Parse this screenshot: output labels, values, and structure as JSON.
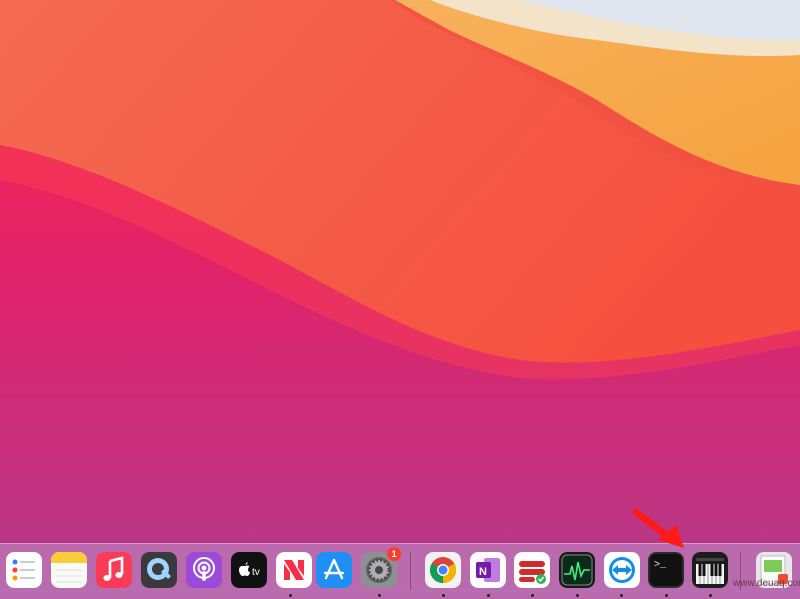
{
  "desktop": {
    "wallpaper": "macOS Big Sur gradient wallpaper"
  },
  "dock": {
    "apps": [
      {
        "name": "Reminders",
        "icon": "reminders-icon"
      },
      {
        "name": "Notes",
        "icon": "notes-icon"
      },
      {
        "name": "Music",
        "icon": "music-icon"
      },
      {
        "name": "QuickTime Player",
        "icon": "quicktime-icon"
      },
      {
        "name": "Podcasts",
        "icon": "podcasts-icon"
      },
      {
        "name": "TV",
        "icon": "apple-tv-icon",
        "label": "tv"
      },
      {
        "name": "News",
        "icon": "news-icon"
      },
      {
        "name": "App Store",
        "icon": "app-store-icon"
      },
      {
        "name": "System Preferences",
        "icon": "system-preferences-icon",
        "badge": "1"
      },
      {
        "name": "Google Chrome",
        "icon": "chrome-icon"
      },
      {
        "name": "OneNote",
        "icon": "onenote-icon",
        "label": "N"
      },
      {
        "name": "Expressions",
        "icon": "expressions-icon"
      },
      {
        "name": "Activity Monitor",
        "icon": "activity-monitor-icon"
      },
      {
        "name": "TeamViewer",
        "icon": "teamviewer-icon"
      },
      {
        "name": "Terminal",
        "icon": "terminal-icon",
        "label": ">_"
      },
      {
        "name": "Piano",
        "icon": "piano-icon"
      },
      {
        "name": "Preview",
        "icon": "preview-icon"
      }
    ]
  },
  "annotation": {
    "arrow_color": "#ff1a1a"
  },
  "watermark": "www.deuaq.com",
  "colors": {
    "badge": "#ff3b30",
    "dock": "#c8a4d0"
  }
}
